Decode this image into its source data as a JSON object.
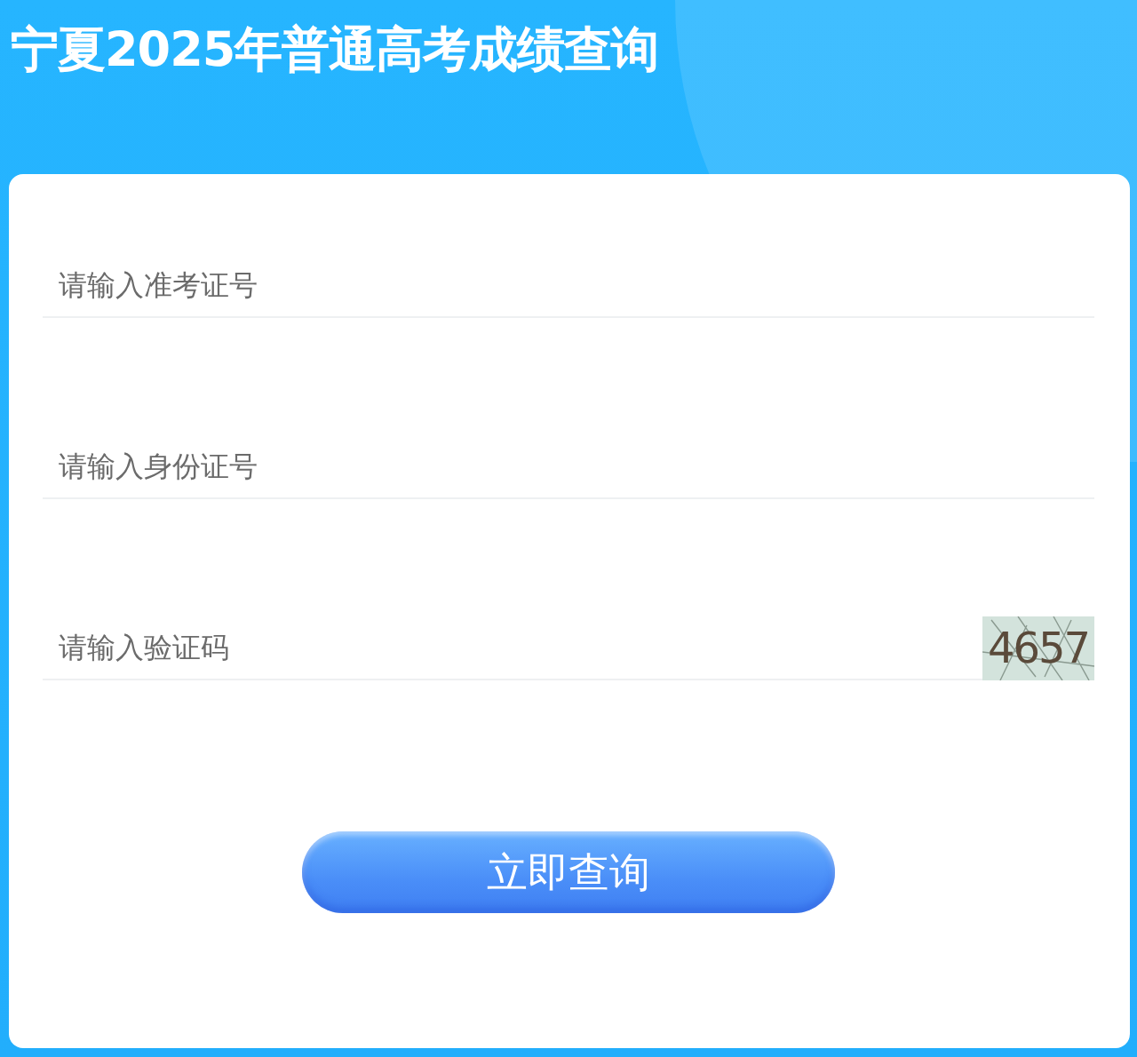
{
  "title": "宁夏2025年普通高考成绩查询",
  "fields": [
    {
      "kind": "text",
      "placeholder": "请输入准考证号"
    },
    {
      "kind": "text",
      "placeholder": "请输入身份证号"
    },
    {
      "kind": "captcha",
      "placeholder": "请输入验证码",
      "captcha": "4657"
    }
  ],
  "submit": "立即查询"
}
